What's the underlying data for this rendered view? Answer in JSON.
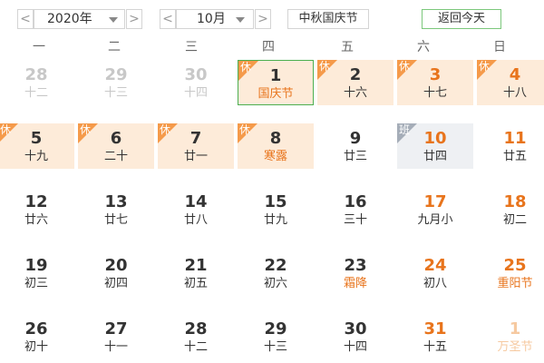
{
  "toolbar": {
    "year": "2020年",
    "month": "10月",
    "holiday_select": "中秋国庆节",
    "today_button": "返回今天",
    "prev_arrow": "<",
    "next_arrow": ">"
  },
  "weekdays": [
    "一",
    "二",
    "三",
    "四",
    "五",
    "六",
    "日"
  ],
  "badges": {
    "rest": "休",
    "work": "班"
  },
  "weeks": [
    [
      {
        "day": "28",
        "lunar": "十二",
        "other": true
      },
      {
        "day": "29",
        "lunar": "十三",
        "other": true
      },
      {
        "day": "30",
        "lunar": "十四",
        "other": true
      },
      {
        "day": "1",
        "lunar": "国庆节",
        "badge": "rest",
        "today": true,
        "lunar_type": "fest"
      },
      {
        "day": "2",
        "lunar": "十六",
        "badge": "rest"
      },
      {
        "day": "3",
        "lunar": "十七",
        "badge": "rest",
        "weekend": true
      },
      {
        "day": "4",
        "lunar": "十八",
        "badge": "rest",
        "weekend": true
      }
    ],
    [
      {
        "day": "5",
        "lunar": "十九",
        "badge": "rest"
      },
      {
        "day": "6",
        "lunar": "二十",
        "badge": "rest"
      },
      {
        "day": "7",
        "lunar": "廿一",
        "badge": "rest"
      },
      {
        "day": "8",
        "lunar": "寒露",
        "badge": "rest",
        "lunar_type": "term"
      },
      {
        "day": "9",
        "lunar": "廿三"
      },
      {
        "day": "10",
        "lunar": "廿四",
        "badge": "work",
        "weekend": true
      },
      {
        "day": "11",
        "lunar": "廿五",
        "weekend": true
      }
    ],
    [
      {
        "day": "12",
        "lunar": "廿六"
      },
      {
        "day": "13",
        "lunar": "廿七"
      },
      {
        "day": "14",
        "lunar": "廿八"
      },
      {
        "day": "15",
        "lunar": "廿九"
      },
      {
        "day": "16",
        "lunar": "三十"
      },
      {
        "day": "17",
        "lunar": "九月小",
        "weekend": true
      },
      {
        "day": "18",
        "lunar": "初二",
        "weekend": true
      }
    ],
    [
      {
        "day": "19",
        "lunar": "初三"
      },
      {
        "day": "20",
        "lunar": "初四"
      },
      {
        "day": "21",
        "lunar": "初五"
      },
      {
        "day": "22",
        "lunar": "初六"
      },
      {
        "day": "23",
        "lunar": "霜降",
        "lunar_type": "term"
      },
      {
        "day": "24",
        "lunar": "初八",
        "weekend": true
      },
      {
        "day": "25",
        "lunar": "重阳节",
        "weekend": true,
        "lunar_type": "fest"
      }
    ],
    [
      {
        "day": "26",
        "lunar": "初十"
      },
      {
        "day": "27",
        "lunar": "十一"
      },
      {
        "day": "28",
        "lunar": "十二"
      },
      {
        "day": "29",
        "lunar": "十三"
      },
      {
        "day": "30",
        "lunar": "十四"
      },
      {
        "day": "31",
        "lunar": "十五",
        "weekend": true
      },
      {
        "day": "1",
        "lunar": "万圣节",
        "weekend": true,
        "other": true,
        "lunar_type": "fest"
      }
    ]
  ],
  "colors": {
    "holiday_bg": "#fdebd9",
    "workday_bg": "#eef0f3",
    "rest_badge": "#f59a4a",
    "work_badge": "#a5adb8",
    "weekend_text": "#e8741c",
    "today_border": "#4caf50"
  }
}
